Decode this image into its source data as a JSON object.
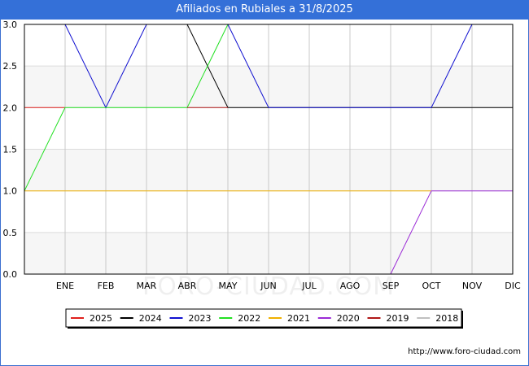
{
  "title": "Afiliados en Rubiales a 31/8/2025",
  "watermark": "FORO-CIUDAD.COM",
  "source": "http://www.foro-ciudad.com",
  "chart_data": {
    "type": "line",
    "title": "Afiliados en Rubiales a 31/8/2025",
    "xlabel": "",
    "ylabel": "",
    "categories": [
      "ENE",
      "FEB",
      "MAR",
      "ABR",
      "MAY",
      "JUN",
      "JUL",
      "AGO",
      "SEP",
      "OCT",
      "NOV",
      "DIC"
    ],
    "ylim": [
      0,
      3
    ],
    "yticks": [
      "0.0",
      "0.5",
      "1.0",
      "1.5",
      "2.0",
      "2.5",
      "3.0"
    ],
    "grid": true,
    "legend_position": "bottom",
    "series": [
      {
        "name": "2025",
        "color": "#e0201c",
        "points": [
          [
            0,
            2
          ],
          [
            1,
            2
          ]
        ]
      },
      {
        "name": "2024",
        "color": "#000000",
        "points": [
          [
            4,
            3
          ],
          [
            5,
            2
          ],
          [
            12,
            2
          ]
        ]
      },
      {
        "name": "2023",
        "color": "#1010d0",
        "points": [
          [
            1,
            3
          ],
          [
            2,
            2
          ],
          [
            3,
            3
          ]
        ]
      },
      {
        "name": "2022",
        "color": "#22e022",
        "points": [
          [
            0,
            1
          ],
          [
            1,
            2
          ],
          [
            4,
            2
          ],
          [
            5,
            3
          ]
        ]
      },
      {
        "name": "2021",
        "color": "#f0b000",
        "points": [
          [
            0,
            1
          ],
          [
            10,
            1
          ]
        ]
      },
      {
        "name": "2020",
        "color": "#9b2bd6",
        "points": [
          [
            9,
            0
          ],
          [
            10,
            1
          ],
          [
            12,
            1
          ]
        ]
      },
      {
        "name": "2019",
        "color": "#b01818",
        "points": [
          [
            4,
            2
          ],
          [
            5,
            2
          ]
        ]
      },
      {
        "name": "2018",
        "color": "#c0c0c0",
        "points": []
      },
      {
        "name": "2023",
        "color": "#1010d0",
        "points": [
          [
            5,
            3
          ],
          [
            6,
            2
          ],
          [
            10,
            2
          ],
          [
            11,
            3
          ]
        ]
      }
    ],
    "legend": [
      {
        "name": "2025",
        "color": "#e0201c"
      },
      {
        "name": "2024",
        "color": "#000000"
      },
      {
        "name": "2023",
        "color": "#1010d0"
      },
      {
        "name": "2022",
        "color": "#22e022"
      },
      {
        "name": "2021",
        "color": "#f0b000"
      },
      {
        "name": "2020",
        "color": "#9b2bd6"
      },
      {
        "name": "2019",
        "color": "#b01818"
      },
      {
        "name": "2018",
        "color": "#c0c0c0"
      }
    ]
  }
}
